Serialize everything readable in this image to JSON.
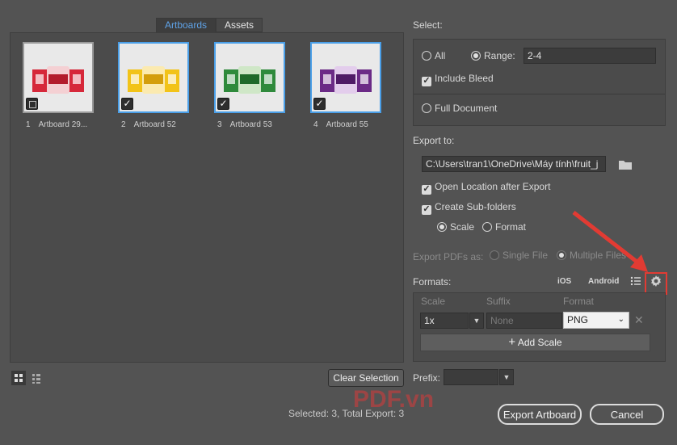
{
  "tabs": [
    {
      "label": "Artboards",
      "active": true
    },
    {
      "label": "Assets",
      "active": false
    }
  ],
  "artboards": [
    {
      "num": "1",
      "name": "Artboard 29...",
      "selected": false,
      "color": "#d6283a"
    },
    {
      "num": "2",
      "name": "Artboard 52",
      "selected": true,
      "color": "#f2c318"
    },
    {
      "num": "3",
      "name": "Artboard 53",
      "selected": true,
      "color": "#2f8a3c"
    },
    {
      "num": "4",
      "name": "Artboard 55",
      "selected": true,
      "color": "#6b2a86"
    }
  ],
  "clear_selection": "Clear Selection",
  "status": "Selected: 3, Total Export: 3",
  "watermark": "PDF.vn",
  "select": {
    "heading": "Select:",
    "all": "All",
    "range": "Range:",
    "range_value": "2-4",
    "include_bleed": "Include Bleed",
    "full_document": "Full Document"
  },
  "export_to": {
    "heading": "Export to:",
    "path": "C:\\Users\\tran1\\OneDrive\\Máy tính\\fruit_j",
    "open_location": "Open Location after Export",
    "create_subfolders": "Create Sub-folders",
    "scale": "Scale",
    "format": "Format"
  },
  "pdf": {
    "label": "Export PDFs as:",
    "single": "Single File",
    "multiple": "Multiple Files"
  },
  "formats": {
    "heading": "Formats:",
    "ios": "iOS",
    "android": "Android",
    "col_scale": "Scale",
    "col_suffix": "Suffix",
    "col_format": "Format",
    "scale_value": "1x",
    "suffix_placeholder": "None",
    "format_value": "PNG",
    "add_scale": "Add Scale"
  },
  "prefix": {
    "label": "Prefix:",
    "value": ""
  },
  "buttons": {
    "export": "Export Artboard",
    "cancel": "Cancel"
  }
}
